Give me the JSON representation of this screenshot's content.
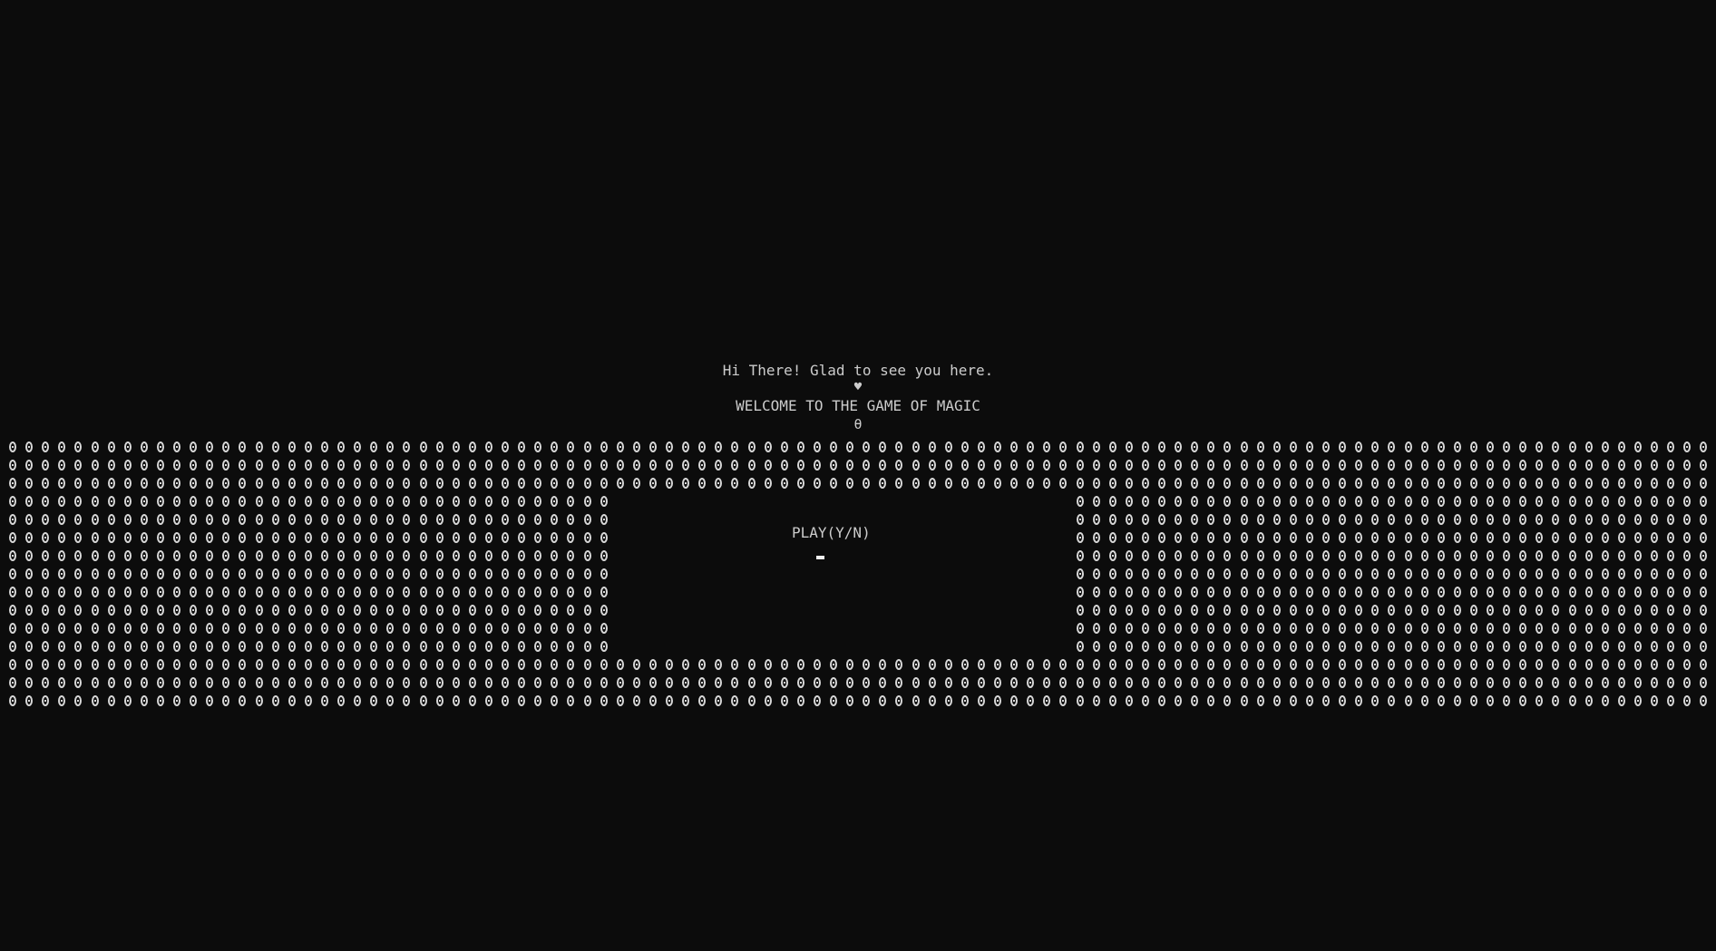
{
  "console": {
    "greeting": "Hi There! Glad to see you here.",
    "heart": "♥",
    "welcome": "WELCOME TO THE GAME OF MAGIC",
    "theta": "θ",
    "prompt": "PLAY(Y/N)",
    "input_value": ""
  },
  "border": {
    "glyph": "0",
    "rows": 15,
    "columns": 104,
    "hollow_rows_start": 3,
    "hollow_rows_end": 11,
    "hollow_cols_start": 37,
    "hollow_cols_end": 64
  },
  "colors": {
    "background": "#0c0c0c",
    "text": "#cccccc",
    "glyph": "#d8d8d8"
  }
}
